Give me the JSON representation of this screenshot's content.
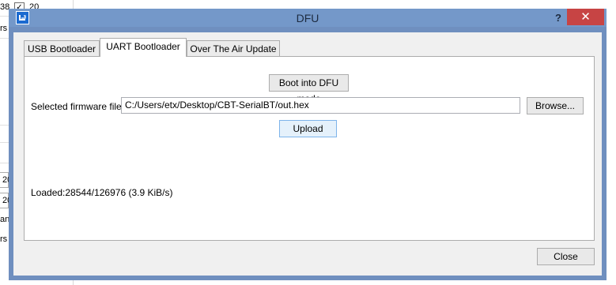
{
  "background_app": {
    "fragments": [
      "38",
      "20",
      "rs",
      "20",
      "20",
      "an",
      "rs"
    ]
  },
  "window": {
    "title": "DFU",
    "help_label": "?",
    "close_label": "✕"
  },
  "tabs": [
    {
      "label": "USB Bootloader",
      "active": false
    },
    {
      "label": "UART Bootloader",
      "active": true
    },
    {
      "label": "Over The Air Update",
      "active": false
    }
  ],
  "uart": {
    "boot_button": "Boot into DFU mode",
    "firmware_label": "Selected firmware file:",
    "firmware_path": "C:/Users/etx/Desktop/CBT-SerialBT/out.hex",
    "browse_button": "Browse...",
    "upload_button": "Upload",
    "status": "Loaded:28544/126976 (3.9 KiB/s)"
  },
  "footer": {
    "close_button": "Close"
  },
  "colors": {
    "title_bar": "#7498c9",
    "close_button": "#c74444",
    "app_icon": "#1b6ad0"
  }
}
